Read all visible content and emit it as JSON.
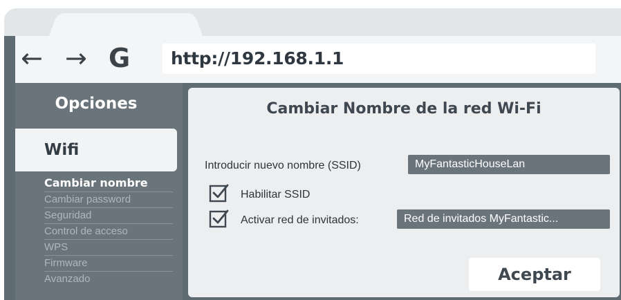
{
  "browser": {
    "back_icon": "←",
    "forward_icon": "→",
    "reload_icon": "G",
    "address": "http://192.168.1.1"
  },
  "sidebar": {
    "title": "Opciones",
    "section": "Wifi",
    "items": [
      {
        "label": "Cambiar nombre",
        "active": true
      },
      {
        "label": "Cambiar password",
        "active": false
      },
      {
        "label": "Seguridad",
        "active": false
      },
      {
        "label": "Control de acceso",
        "active": false
      },
      {
        "label": "WPS",
        "active": false
      },
      {
        "label": "Firmware",
        "active": false
      },
      {
        "label": "Avanzado",
        "active": false
      }
    ]
  },
  "main": {
    "title": "Cambiar Nombre de la red Wi-Fi",
    "ssid_label": "Introducir nuevo nombre (SSID)",
    "ssid_value": "MyFantasticHouseLan",
    "enable_ssid_label": "Habilitar SSID",
    "enable_ssid_checked": true,
    "guest_label": "Activar red de invitados:",
    "guest_checked": true,
    "guest_value": "Red de invitados MyFantastic...",
    "accept_label": "Aceptar"
  }
}
